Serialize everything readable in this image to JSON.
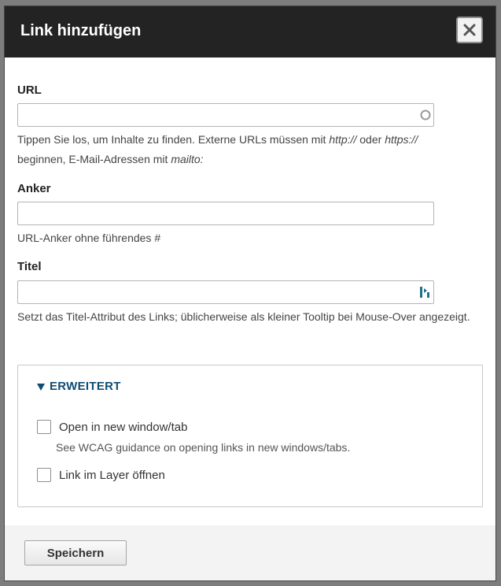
{
  "dialog": {
    "title": "Link hinzufügen",
    "close_label": "×"
  },
  "url": {
    "label": "URL",
    "value": "",
    "placeholder": "",
    "description_parts": {
      "a": "Tippen Sie los, um Inhalte zu finden. Externe URLs müssen mit ",
      "b": "http://",
      "c": " oder ",
      "d": "https://",
      "e": " beginnen, E-Mail-Adressen mit ",
      "f": "mailto:"
    }
  },
  "anchor": {
    "label": "Anker",
    "value": "",
    "description": "URL-Anker ohne führendes #"
  },
  "title_field": {
    "label": "Titel",
    "value": "",
    "description": "Setzt das Titel-Attribut des Links; üblicherweise als kleiner Tooltip bei Mouse-Over angezeigt."
  },
  "advanced": {
    "toggle_label": "ERWEITERT",
    "new_window": {
      "label": "Open in new window/tab",
      "description": "See WCAG guidance on opening links in new windows/tabs."
    },
    "layer": {
      "label": "Link im Layer öffnen"
    }
  },
  "footer": {
    "save_label": "Speichern"
  },
  "colors": {
    "titlebar": "#232323",
    "accent": "#0f4c73",
    "footer": "#f3f3f3"
  }
}
